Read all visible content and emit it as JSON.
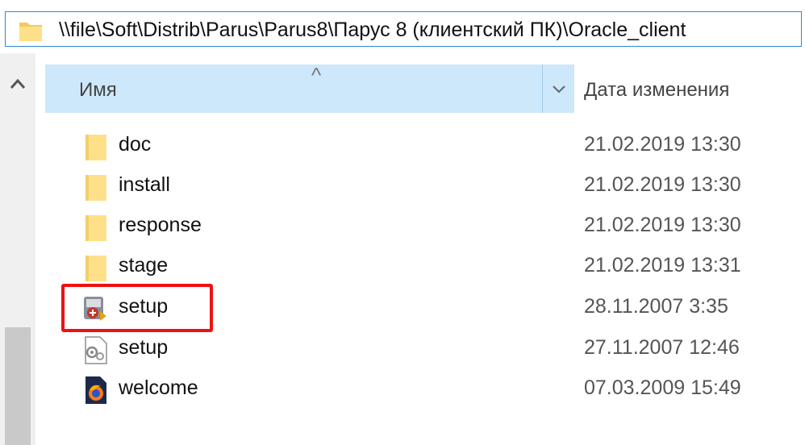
{
  "address_bar": {
    "path": "\\\\file\\Soft\\Distrib\\Parus\\Parus8\\Парус 8 (клиентский ПК)\\Oracle_client",
    "icon": "folder-icon"
  },
  "columns": {
    "name_label": "Имя",
    "date_label": "Дата изменения",
    "sort_glyph": "^"
  },
  "files": [
    {
      "name": "doc",
      "date": "21.02.2019 13:30",
      "icon": "folder-icon"
    },
    {
      "name": "install",
      "date": "21.02.2019 13:30",
      "icon": "folder-icon"
    },
    {
      "name": "response",
      "date": "21.02.2019 13:30",
      "icon": "folder-icon"
    },
    {
      "name": "stage",
      "date": "21.02.2019 13:31",
      "icon": "folder-icon"
    },
    {
      "name": "setup",
      "date": "28.11.2007 3:35",
      "icon": "installer-exe-icon"
    },
    {
      "name": "setup",
      "date": "27.11.2007 12:46",
      "icon": "config-file-icon"
    },
    {
      "name": "welcome",
      "date": "07.03.2009 15:49",
      "icon": "firefox-html-icon"
    }
  ],
  "colors": {
    "highlight": "#ee1111",
    "header_bg": "#cde8fa",
    "address_border": "#2f86d6"
  }
}
